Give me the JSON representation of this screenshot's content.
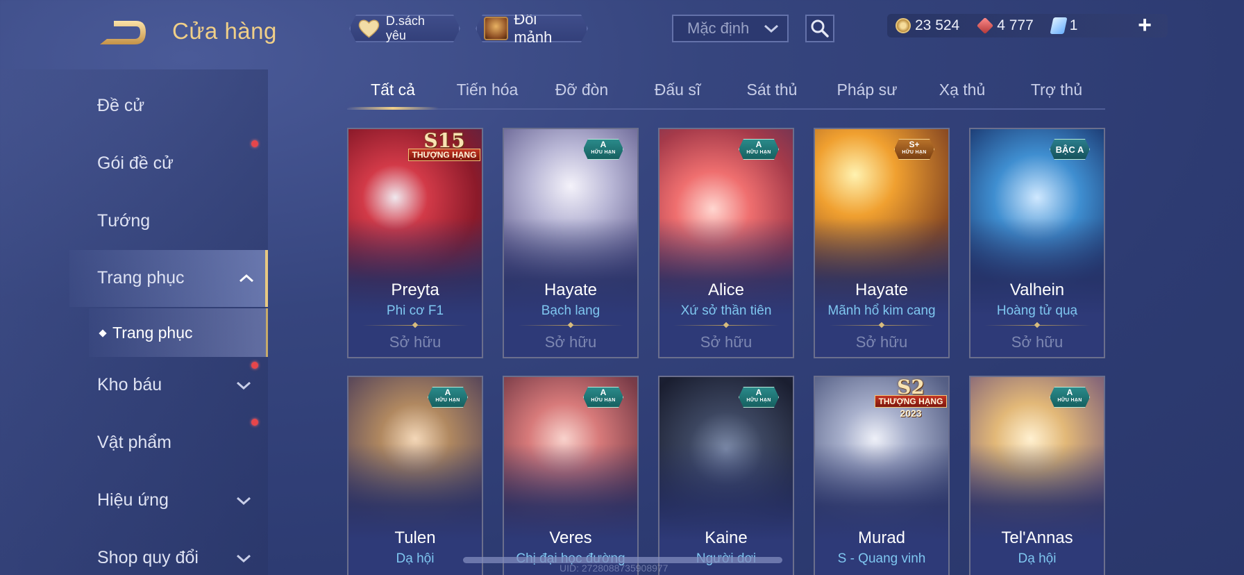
{
  "header": {
    "title": "Cửa hàng",
    "favorites_label": "D.sách yêu",
    "fragments_label": "Đổi mảnh",
    "sort_value": "Mặc định"
  },
  "currency": {
    "gold": "23 524",
    "coupons": "4 777",
    "cards": "1"
  },
  "sidebar": {
    "items": [
      {
        "label": "Đề cử"
      },
      {
        "label": "Gói đề cử"
      },
      {
        "label": "Tướng"
      },
      {
        "label": "Trang phục"
      },
      {
        "label": "Trang phục"
      },
      {
        "label": "Kho báu"
      },
      {
        "label": "Vật phẩm"
      },
      {
        "label": "Hiệu ứng"
      },
      {
        "label": "Shop quy đổi"
      }
    ]
  },
  "tabs": [
    {
      "label": "Tất cả"
    },
    {
      "label": "Tiến hóa"
    },
    {
      "label": "Đỡ đòn"
    },
    {
      "label": "Đấu sĩ"
    },
    {
      "label": "Sát thủ"
    },
    {
      "label": "Pháp sư"
    },
    {
      "label": "Xạ thủ"
    },
    {
      "label": "Trợ thủ"
    }
  ],
  "cards": [
    {
      "hero": "Preyta",
      "skin": "Phi cơ F1",
      "status": "Sở hữu",
      "badge": "S15",
      "badge_sub": "THƯỢNG HẠNG"
    },
    {
      "hero": "Hayate",
      "skin": "Bạch lang",
      "status": "Sở hữu",
      "badge": "A",
      "badge_sub": "HỮU HẠN"
    },
    {
      "hero": "Alice",
      "skin": "Xứ sở thần tiên",
      "status": "Sở hữu",
      "badge": "A",
      "badge_sub": "HỮU HẠN"
    },
    {
      "hero": "Hayate",
      "skin": "Mãnh hổ kim cang",
      "status": "Sở hữu",
      "badge": "S+",
      "badge_sub": "HỮU HẠN"
    },
    {
      "hero": "Valhein",
      "skin": "Hoàng tử quạ",
      "status": "Sở hữu",
      "badge": "BẬC A",
      "badge_sub": ""
    },
    {
      "hero": "Tulen",
      "skin": "Dạ hội",
      "status": "",
      "badge": "A",
      "badge_sub": "HỮU HẠN"
    },
    {
      "hero": "Veres",
      "skin": "Chị đại học đường",
      "status": "",
      "badge": "A",
      "badge_sub": "HỮU HẠN"
    },
    {
      "hero": "Kaine",
      "skin": "Người dơi",
      "status": "",
      "badge": "A",
      "badge_sub": "HỮU HẠN"
    },
    {
      "hero": "Murad",
      "skin": "S - Quang vinh",
      "status": "",
      "badge": "S2",
      "badge_sub": "THƯỢNG HẠNG",
      "badge_year": "2023"
    },
    {
      "hero": "Tel'Annas",
      "skin": "Dạ hội",
      "status": "",
      "badge": "A",
      "badge_sub": "HỮU HẠN"
    }
  ],
  "footer": {
    "uid": "UID: 2728088735908977"
  },
  "colors": {
    "accent_gold": "#f0cf88",
    "skin_name_blue": "#7fc7f0",
    "notification_red": "#e6464b"
  },
  "icons": [
    "back-arrow-icon",
    "heart-icon",
    "chest-icon",
    "chevron-down-icon",
    "search-icon",
    "gold-coin-icon",
    "voucher-gem-icon",
    "card-icon",
    "plus-icon",
    "chevron-up-icon",
    "diamond-bullet-icon"
  ]
}
